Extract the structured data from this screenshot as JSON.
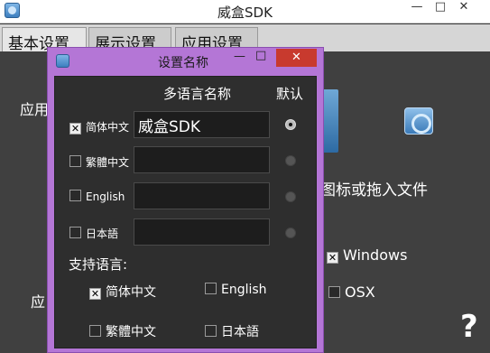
{
  "window": {
    "title": "威盒SDK",
    "minimize": "—",
    "maximize": "□",
    "close": "✕"
  },
  "tabs": [
    {
      "label": "基本设置",
      "active": true
    },
    {
      "label": "展示设置",
      "active": false
    },
    {
      "label": "应用设置",
      "active": false
    }
  ],
  "background": {
    "apply_label_1": "应用",
    "apply_label_2": "应",
    "drop_hint": "图标或拖入文件",
    "platforms": [
      {
        "label": "Windows",
        "checked": true
      },
      {
        "label": "OSX",
        "checked": false
      }
    ],
    "help": "?"
  },
  "dialog": {
    "title": "设置名称",
    "minimize": "—",
    "maximize": "□",
    "close": "✕",
    "header_name": "多语言名称",
    "header_default": "默认",
    "rows": [
      {
        "lang": "简体中文",
        "checked": true,
        "value": "威盒SDK",
        "is_default": true
      },
      {
        "lang": "繁體中文",
        "checked": false,
        "value": "",
        "is_default": false
      },
      {
        "lang": "English",
        "checked": false,
        "value": "",
        "is_default": false
      },
      {
        "lang": "日本語",
        "checked": false,
        "value": "",
        "is_default": false
      }
    ],
    "support_label": "支持语言:",
    "supported": [
      {
        "lang": "简体中文",
        "checked": true
      },
      {
        "lang": "English",
        "checked": false
      },
      {
        "lang": "繁體中文",
        "checked": false
      },
      {
        "lang": "日本語",
        "checked": false
      }
    ]
  },
  "colors": {
    "dialog_border": "#b476d6",
    "close_button": "#c83a2e",
    "background": "#404040"
  }
}
